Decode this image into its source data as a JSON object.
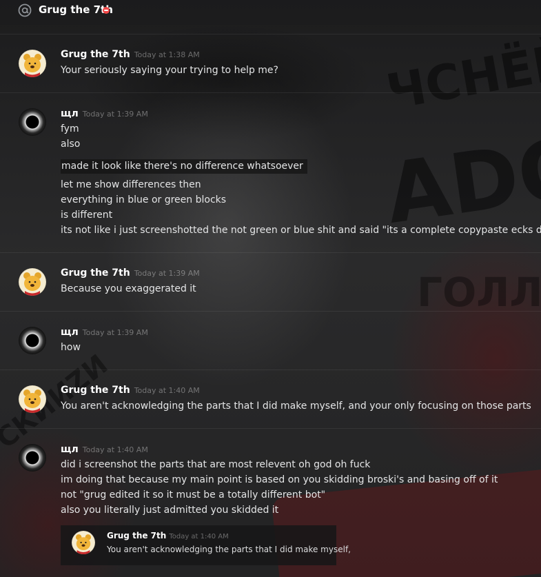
{
  "header": {
    "icon": "at-sign-icon",
    "title": "Grug the 7th",
    "status": "do-not-disturb"
  },
  "colors": {
    "background": "#1f1f20",
    "text": "#dcddde",
    "timestamp": "#8e8e8f",
    "dnd": "#f04747"
  },
  "messages": [
    {
      "author": "Grug the 7th",
      "avatar": "winnie-the-pooh-avatar",
      "timestamp": "Today at 1:38 AM",
      "lines": [
        "Your seriously saying your trying to help me?"
      ]
    },
    {
      "author": "щл",
      "avatar": "eclipse-avatar",
      "timestamp": "Today at 1:39 AM",
      "lines": [
        "fym",
        "also",
        "made it look like there's no difference whatsoever",
        "let me show differences then",
        "everything in blue or green blocks",
        "is different",
        "its not like i just screenshotted the not green or blue shit and said \"its a complete copypaste ecks dee\""
      ]
    },
    {
      "author": "Grug the 7th",
      "avatar": "winnie-the-pooh-avatar",
      "timestamp": "Today at 1:39 AM",
      "lines": [
        "Because you exaggerated it"
      ]
    },
    {
      "author": "щл",
      "avatar": "eclipse-avatar",
      "timestamp": "Today at 1:39 AM",
      "lines": [
        "how"
      ]
    },
    {
      "author": "Grug the 7th",
      "avatar": "winnie-the-pooh-avatar",
      "timestamp": "Today at 1:40 AM",
      "lines": [
        "You aren't acknowledging the parts that I did make myself, and your only focusing on those parts"
      ]
    },
    {
      "author": "щл",
      "avatar": "eclipse-avatar",
      "timestamp": "Today at 1:40 AM",
      "lines": [
        "did i screenshot the parts that are most relevent oh god oh fuck",
        "im doing that because my main point is based on you skidding broski's and basing off of it",
        "not \"grug edited it so it must be a totally different bot\"",
        "also you literally just admitted you skidded it"
      ],
      "quote": {
        "author": "Grug the 7th",
        "avatar": "winnie-the-pooh-avatar",
        "timestamp": "Today at 1:40 AM",
        "text": "You aren't acknowledging the parts that I did make myself,"
      }
    }
  ]
}
